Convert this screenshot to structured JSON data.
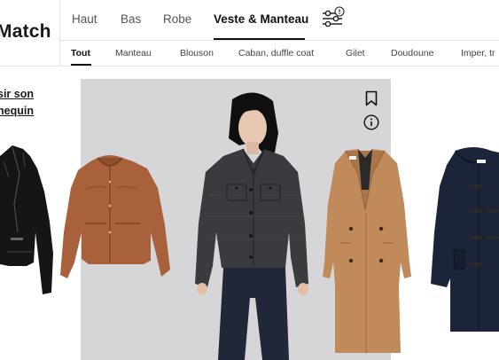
{
  "brand": {
    "name": "Match"
  },
  "topnav": {
    "items": [
      {
        "label": "Haut"
      },
      {
        "label": "Bas"
      },
      {
        "label": "Robe"
      },
      {
        "label": "Veste & Manteau"
      }
    ],
    "active_index": 3,
    "filter_icon": "filter-sliders-icon"
  },
  "subnav": {
    "items": [
      {
        "label": "Tout"
      },
      {
        "label": "Manteau"
      },
      {
        "label": "Blouson"
      },
      {
        "label": "Caban, duffle coat"
      },
      {
        "label": "Gilet"
      },
      {
        "label": "Doudoune"
      },
      {
        "label": "Imper, tr"
      }
    ],
    "active_index": 0
  },
  "sidebar": {
    "choose_line1": "sir son",
    "choose_line2": "nequin"
  },
  "carousel": {
    "items": [
      {
        "name": "black-leather-biker-jacket",
        "color": "#151515"
      },
      {
        "name": "tan-leather-collarless-jacket",
        "color": "#a8613a"
      },
      {
        "name": "grey-check-shirt-jacket-on-model",
        "color": "#3a3b3e"
      },
      {
        "name": "camel-double-breasted-coat",
        "color": "#c08a5a"
      },
      {
        "name": "navy-duffle-coat",
        "color": "#1b2438"
      }
    ]
  },
  "icons": {
    "bookmark": "bookmark-icon",
    "info": "info-icon"
  },
  "colors": {
    "text": "#1a1a1a",
    "muted": "#555555",
    "stage_bg": "#d6d6d8",
    "accent": "#111111"
  }
}
